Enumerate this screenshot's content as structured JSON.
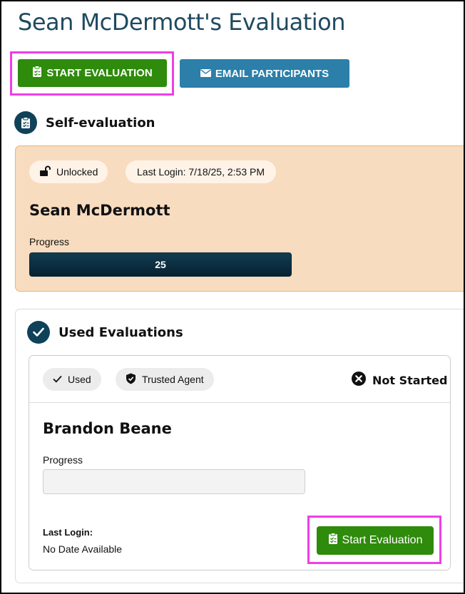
{
  "page": {
    "title": "Sean McDermott's Evaluation"
  },
  "toolbar": {
    "start_label": "START EVALUATION",
    "email_label": "EMAIL PARTICIPANTS"
  },
  "self_eval": {
    "heading": "Self-evaluation",
    "lock_status": "Unlocked",
    "last_login": "Last Login: 7/18/25, 2:53 PM",
    "name": "Sean McDermott",
    "progress_label": "Progress",
    "progress_value": "25"
  },
  "used_evals": {
    "heading": "Used Evaluations",
    "card": {
      "used_tag": "Used",
      "trusted_tag": "Trusted Agent",
      "status": "Not Started",
      "name": "Brandon Beane",
      "progress_label": "Progress",
      "last_login_label": "Last Login:",
      "last_login_value": "No Date Available",
      "start_label": "Start Evaluation"
    }
  },
  "colors": {
    "accent_green": "#2e8b0b",
    "accent_blue": "#2b7fa9",
    "highlight": "#ee3fe6",
    "title": "#1f4a60"
  }
}
